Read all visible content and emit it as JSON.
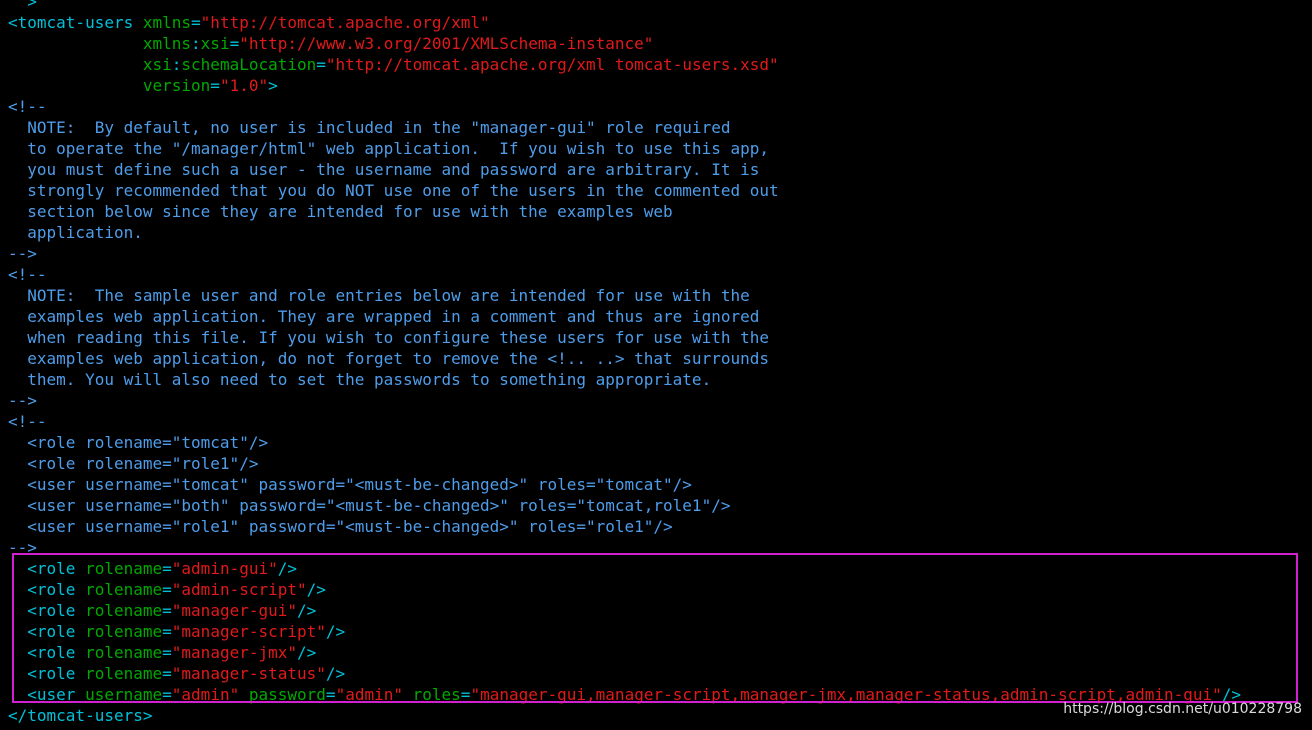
{
  "colors": {
    "background": "#000000",
    "tag": "#00c0d8",
    "attribute": "#00a800",
    "value": "#e01a1a",
    "comment": "#4f9dea",
    "highlight_border": "#d020d0"
  },
  "lines": [
    {
      "id": 0,
      "segs": [
        [
          "c-tag",
          "  >"
        ]
      ]
    },
    {
      "id": 1,
      "segs": [
        [
          "c-tag",
          "<tomcat-users"
        ],
        [
          "c-attr",
          " xmlns"
        ],
        [
          "c-punct",
          "="
        ],
        [
          "c-val",
          "\"http://tomcat.apache.org/xml\""
        ]
      ]
    },
    {
      "id": 2,
      "segs": [
        [
          "c-attr",
          "              xmlns"
        ],
        [
          "c-punct",
          ":"
        ],
        [
          "c-attr",
          "xsi"
        ],
        [
          "c-punct",
          "="
        ],
        [
          "c-val",
          "\"http://www.w3.org/2001/XMLSchema-instance\""
        ]
      ]
    },
    {
      "id": 3,
      "segs": [
        [
          "c-attr",
          "              xsi"
        ],
        [
          "c-punct",
          ":"
        ],
        [
          "c-attr",
          "schemaLocation"
        ],
        [
          "c-punct",
          "="
        ],
        [
          "c-val",
          "\"http://tomcat.apache.org/xml tomcat-users.xsd\""
        ]
      ]
    },
    {
      "id": 4,
      "segs": [
        [
          "c-attr",
          "              version"
        ],
        [
          "c-punct",
          "="
        ],
        [
          "c-val",
          "\"1.0\""
        ],
        [
          "c-tag",
          ">"
        ]
      ]
    },
    {
      "id": 5,
      "segs": [
        [
          "c-com",
          "<!--"
        ]
      ]
    },
    {
      "id": 6,
      "segs": [
        [
          "c-com",
          "  NOTE:  By default, no user is included in the \"manager-gui\" role required"
        ]
      ]
    },
    {
      "id": 7,
      "segs": [
        [
          "c-com",
          "  to operate the \"/manager/html\" web application.  If you wish to use this app,"
        ]
      ]
    },
    {
      "id": 8,
      "segs": [
        [
          "c-com",
          "  you must define such a user - the username and password are arbitrary. It is"
        ]
      ]
    },
    {
      "id": 9,
      "segs": [
        [
          "c-com",
          "  strongly recommended that you do NOT use one of the users in the commented out"
        ]
      ]
    },
    {
      "id": 10,
      "segs": [
        [
          "c-com",
          "  section below since they are intended for use with the examples web"
        ]
      ]
    },
    {
      "id": 11,
      "segs": [
        [
          "c-com",
          "  application."
        ]
      ]
    },
    {
      "id": 12,
      "segs": [
        [
          "c-com",
          "-->"
        ]
      ]
    },
    {
      "id": 13,
      "segs": [
        [
          "c-com",
          "<!--"
        ]
      ]
    },
    {
      "id": 14,
      "segs": [
        [
          "c-com",
          "  NOTE:  The sample user and role entries below are intended for use with the"
        ]
      ]
    },
    {
      "id": 15,
      "segs": [
        [
          "c-com",
          "  examples web application. They are wrapped in a comment and thus are ignored"
        ]
      ]
    },
    {
      "id": 16,
      "segs": [
        [
          "c-com",
          "  when reading this file. If you wish to configure these users for use with the"
        ]
      ]
    },
    {
      "id": 17,
      "segs": [
        [
          "c-com",
          "  examples web application, do not forget to remove the <!.. ..> that surrounds"
        ]
      ]
    },
    {
      "id": 18,
      "segs": [
        [
          "c-com",
          "  them. You will also need to set the passwords to something appropriate."
        ]
      ]
    },
    {
      "id": 19,
      "segs": [
        [
          "c-com",
          "-->"
        ]
      ]
    },
    {
      "id": 20,
      "segs": [
        [
          "c-com",
          "<!--"
        ]
      ]
    },
    {
      "id": 21,
      "segs": [
        [
          "c-com",
          "  <role rolename=\"tomcat\"/>"
        ]
      ]
    },
    {
      "id": 22,
      "segs": [
        [
          "c-com",
          "  <role rolename=\"role1\"/>"
        ]
      ]
    },
    {
      "id": 23,
      "segs": [
        [
          "c-com",
          "  <user username=\"tomcat\" password=\"<must-be-changed>\" roles=\"tomcat\"/>"
        ]
      ]
    },
    {
      "id": 24,
      "segs": [
        [
          "c-com",
          "  <user username=\"both\" password=\"<must-be-changed>\" roles=\"tomcat,role1\"/>"
        ]
      ]
    },
    {
      "id": 25,
      "segs": [
        [
          "c-com",
          "  <user username=\"role1\" password=\"<must-be-changed>\" roles=\"role1\"/>"
        ]
      ]
    },
    {
      "id": 26,
      "segs": [
        [
          "c-com",
          "-->"
        ]
      ]
    },
    {
      "id": 27,
      "segs": [
        [
          "c-tag",
          "  <role"
        ],
        [
          "c-attr",
          " rolename"
        ],
        [
          "c-punct",
          "="
        ],
        [
          "c-val",
          "\"admin-gui\""
        ],
        [
          "c-tag",
          "/>"
        ]
      ]
    },
    {
      "id": 28,
      "segs": [
        [
          "c-tag",
          "  <role"
        ],
        [
          "c-attr",
          " rolename"
        ],
        [
          "c-punct",
          "="
        ],
        [
          "c-val",
          "\"admin-script\""
        ],
        [
          "c-tag",
          "/>"
        ]
      ]
    },
    {
      "id": 29,
      "segs": [
        [
          "c-tag",
          "  <role"
        ],
        [
          "c-attr",
          " rolename"
        ],
        [
          "c-punct",
          "="
        ],
        [
          "c-val",
          "\"manager-gui\""
        ],
        [
          "c-tag",
          "/>"
        ]
      ]
    },
    {
      "id": 30,
      "segs": [
        [
          "c-tag",
          "  <role"
        ],
        [
          "c-attr",
          " rolename"
        ],
        [
          "c-punct",
          "="
        ],
        [
          "c-val",
          "\"manager-script\""
        ],
        [
          "c-tag",
          "/>"
        ]
      ]
    },
    {
      "id": 31,
      "segs": [
        [
          "c-tag",
          "  <role"
        ],
        [
          "c-attr",
          " rolename"
        ],
        [
          "c-punct",
          "="
        ],
        [
          "c-val",
          "\"manager-jmx\""
        ],
        [
          "c-tag",
          "/>"
        ]
      ]
    },
    {
      "id": 32,
      "segs": [
        [
          "c-tag",
          "  <role"
        ],
        [
          "c-attr",
          " rolename"
        ],
        [
          "c-punct",
          "="
        ],
        [
          "c-val",
          "\"manager-status\""
        ],
        [
          "c-tag",
          "/>"
        ]
      ]
    },
    {
      "id": 33,
      "segs": [
        [
          "c-tag",
          "  <user"
        ],
        [
          "c-attr",
          " username"
        ],
        [
          "c-punct",
          "="
        ],
        [
          "c-val",
          "\"admin\""
        ],
        [
          "c-attr",
          " password"
        ],
        [
          "c-punct",
          "="
        ],
        [
          "c-val",
          "\"admin\""
        ],
        [
          "c-attr",
          " roles"
        ],
        [
          "c-punct",
          "="
        ],
        [
          "c-val",
          "\"manager-gui,manager-script,manager-jmx,manager-status,admin-script,admin-gui\""
        ],
        [
          "c-tag",
          "/>"
        ]
      ]
    },
    {
      "id": 34,
      "segs": [
        [
          "c-tag",
          "</tomcat-users>"
        ]
      ]
    }
  ],
  "watermark": "https://blog.csdn.net/u010228798"
}
